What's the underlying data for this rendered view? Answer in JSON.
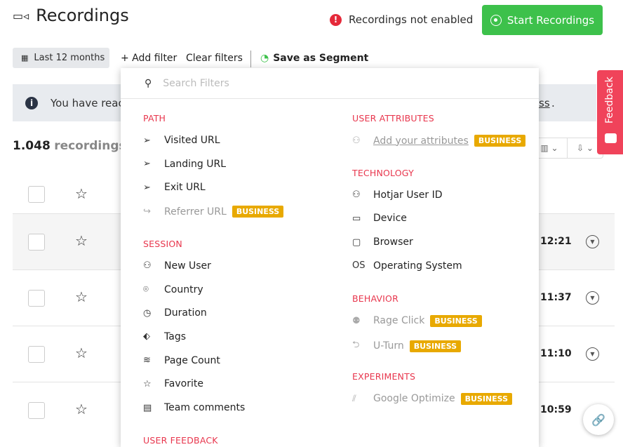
{
  "header": {
    "title": "Recordings",
    "warning": "Recordings not enabled",
    "start_button": "Start Recordings"
  },
  "filters": {
    "date": "Last 12 months",
    "add": "+ Add filter",
    "clear": "Clear filters",
    "segment": "Save as Segment"
  },
  "banner": {
    "text_start": "You have reac",
    "text_end": "ss",
    "period": "."
  },
  "count": {
    "number": "1.048",
    "label": "recordings"
  },
  "feedback": "Feedback",
  "rows": [
    {
      "time": "12:21"
    },
    {
      "time": "11:37"
    },
    {
      "time": "11:10"
    },
    {
      "time": "10:59"
    }
  ],
  "dropdown": {
    "search_placeholder": "Search Filters",
    "left": [
      {
        "section": "PATH",
        "items": [
          {
            "label": "Visited URL",
            "icon": "navigation-arrow-icon"
          },
          {
            "label": "Landing URL",
            "icon": "navigation-arrow-icon"
          },
          {
            "label": "Exit URL",
            "icon": "navigation-arrow-icon"
          },
          {
            "label": "Referrer URL",
            "icon": "share-arrow-icon",
            "badge": "BUSINESS",
            "disabled": true
          }
        ]
      },
      {
        "section": "SESSION",
        "items": [
          {
            "label": "New User",
            "icon": "user-plus-icon"
          },
          {
            "label": "Country",
            "icon": "map-pin-icon"
          },
          {
            "label": "Duration",
            "icon": "clock-icon"
          },
          {
            "label": "Tags",
            "icon": "tag-icon"
          },
          {
            "label": "Page Count",
            "icon": "layers-icon"
          },
          {
            "label": "Favorite",
            "icon": "star-icon"
          },
          {
            "label": "Team comments",
            "icon": "comment-icon"
          }
        ]
      },
      {
        "section": "USER FEEDBACK",
        "items": []
      }
    ],
    "right": [
      {
        "section": "USER ATTRIBUTES",
        "items": [
          {
            "label": "Add your attributes",
            "icon": "user-attributes-icon",
            "badge": "BUSINESS",
            "disabled": true,
            "link": true
          }
        ]
      },
      {
        "section": "TECHNOLOGY",
        "items": [
          {
            "label": "Hotjar User ID",
            "icon": "user-icon"
          },
          {
            "label": "Device",
            "icon": "monitor-icon"
          },
          {
            "label": "Browser",
            "icon": "browser-window-icon"
          },
          {
            "label": "Operating System",
            "icon": "os-icon"
          }
        ]
      },
      {
        "section": "BEHAVIOR",
        "items": [
          {
            "label": "Rage Click",
            "icon": "rage-click-icon",
            "badge": "BUSINESS",
            "disabled": true
          },
          {
            "label": "U-Turn",
            "icon": "u-turn-icon",
            "badge": "BUSINESS",
            "disabled": true
          }
        ]
      },
      {
        "section": "EXPERIMENTS",
        "items": [
          {
            "label": "Google Optimize",
            "icon": "google-optimize-icon",
            "badge": "BUSINESS",
            "disabled": true
          }
        ]
      }
    ]
  }
}
